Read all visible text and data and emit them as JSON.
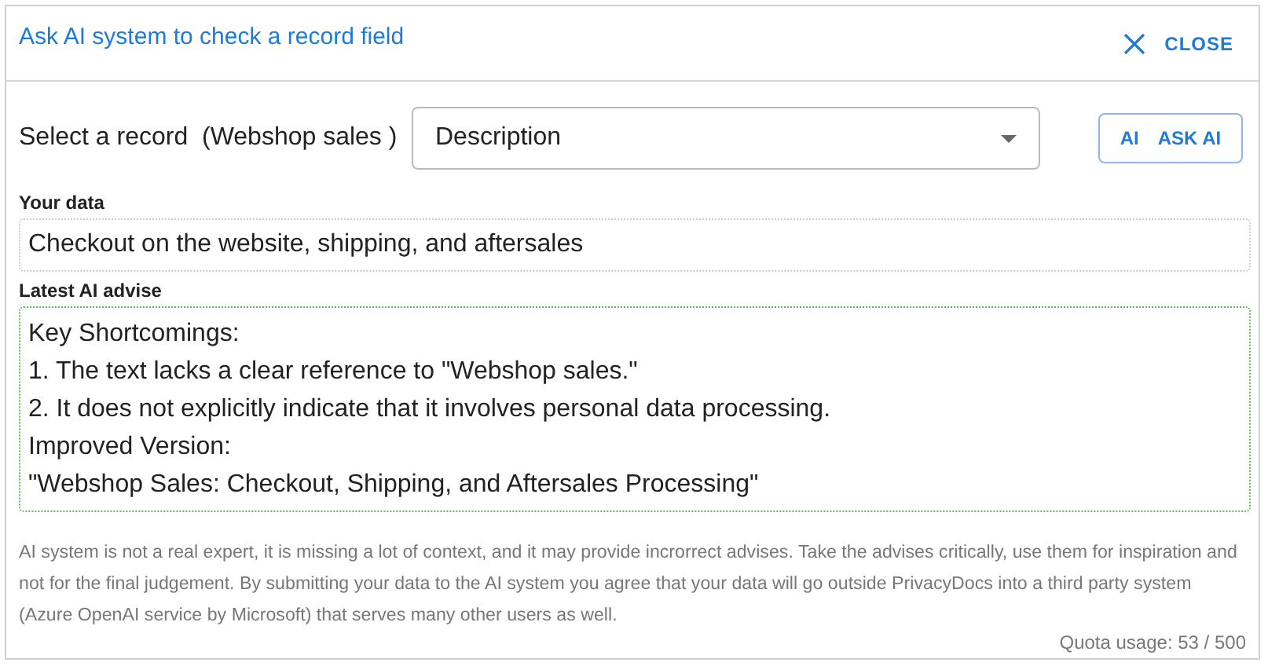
{
  "dialog": {
    "title": "Ask AI system to check a record field",
    "close_button": "CLOSE"
  },
  "record_select": {
    "label": "Select a record  (Webshop sales )",
    "value": "Description"
  },
  "ask_button": {
    "icon_text": "AI",
    "label": "ASK AI"
  },
  "your_data": {
    "label": "Your data",
    "value": "Checkout on the website, shipping, and aftersales"
  },
  "advice": {
    "label": "Latest AI advise",
    "lines": [
      "Key Shortcomings:",
      "1. The text lacks a clear reference to \"Webshop sales.\"",
      "2. It does not explicitly indicate that it involves personal data processing.",
      "Improved Version:",
      "\"Webshop Sales: Checkout, Shipping, and Aftersales Processing\""
    ]
  },
  "disclaimer": "AI system is not a real expert, it is missing a lot of context, and it may provide incrorrect advises. Take the advises critically, use them for inspiration and not for the final judgement. By submitting your data to the AI system you agree that your data will go outside PrivacyDocs into a third party system (Azure OpenAI service by Microsoft) that serves many other users as well.",
  "quota": "Quota usage: 53 / 500"
}
